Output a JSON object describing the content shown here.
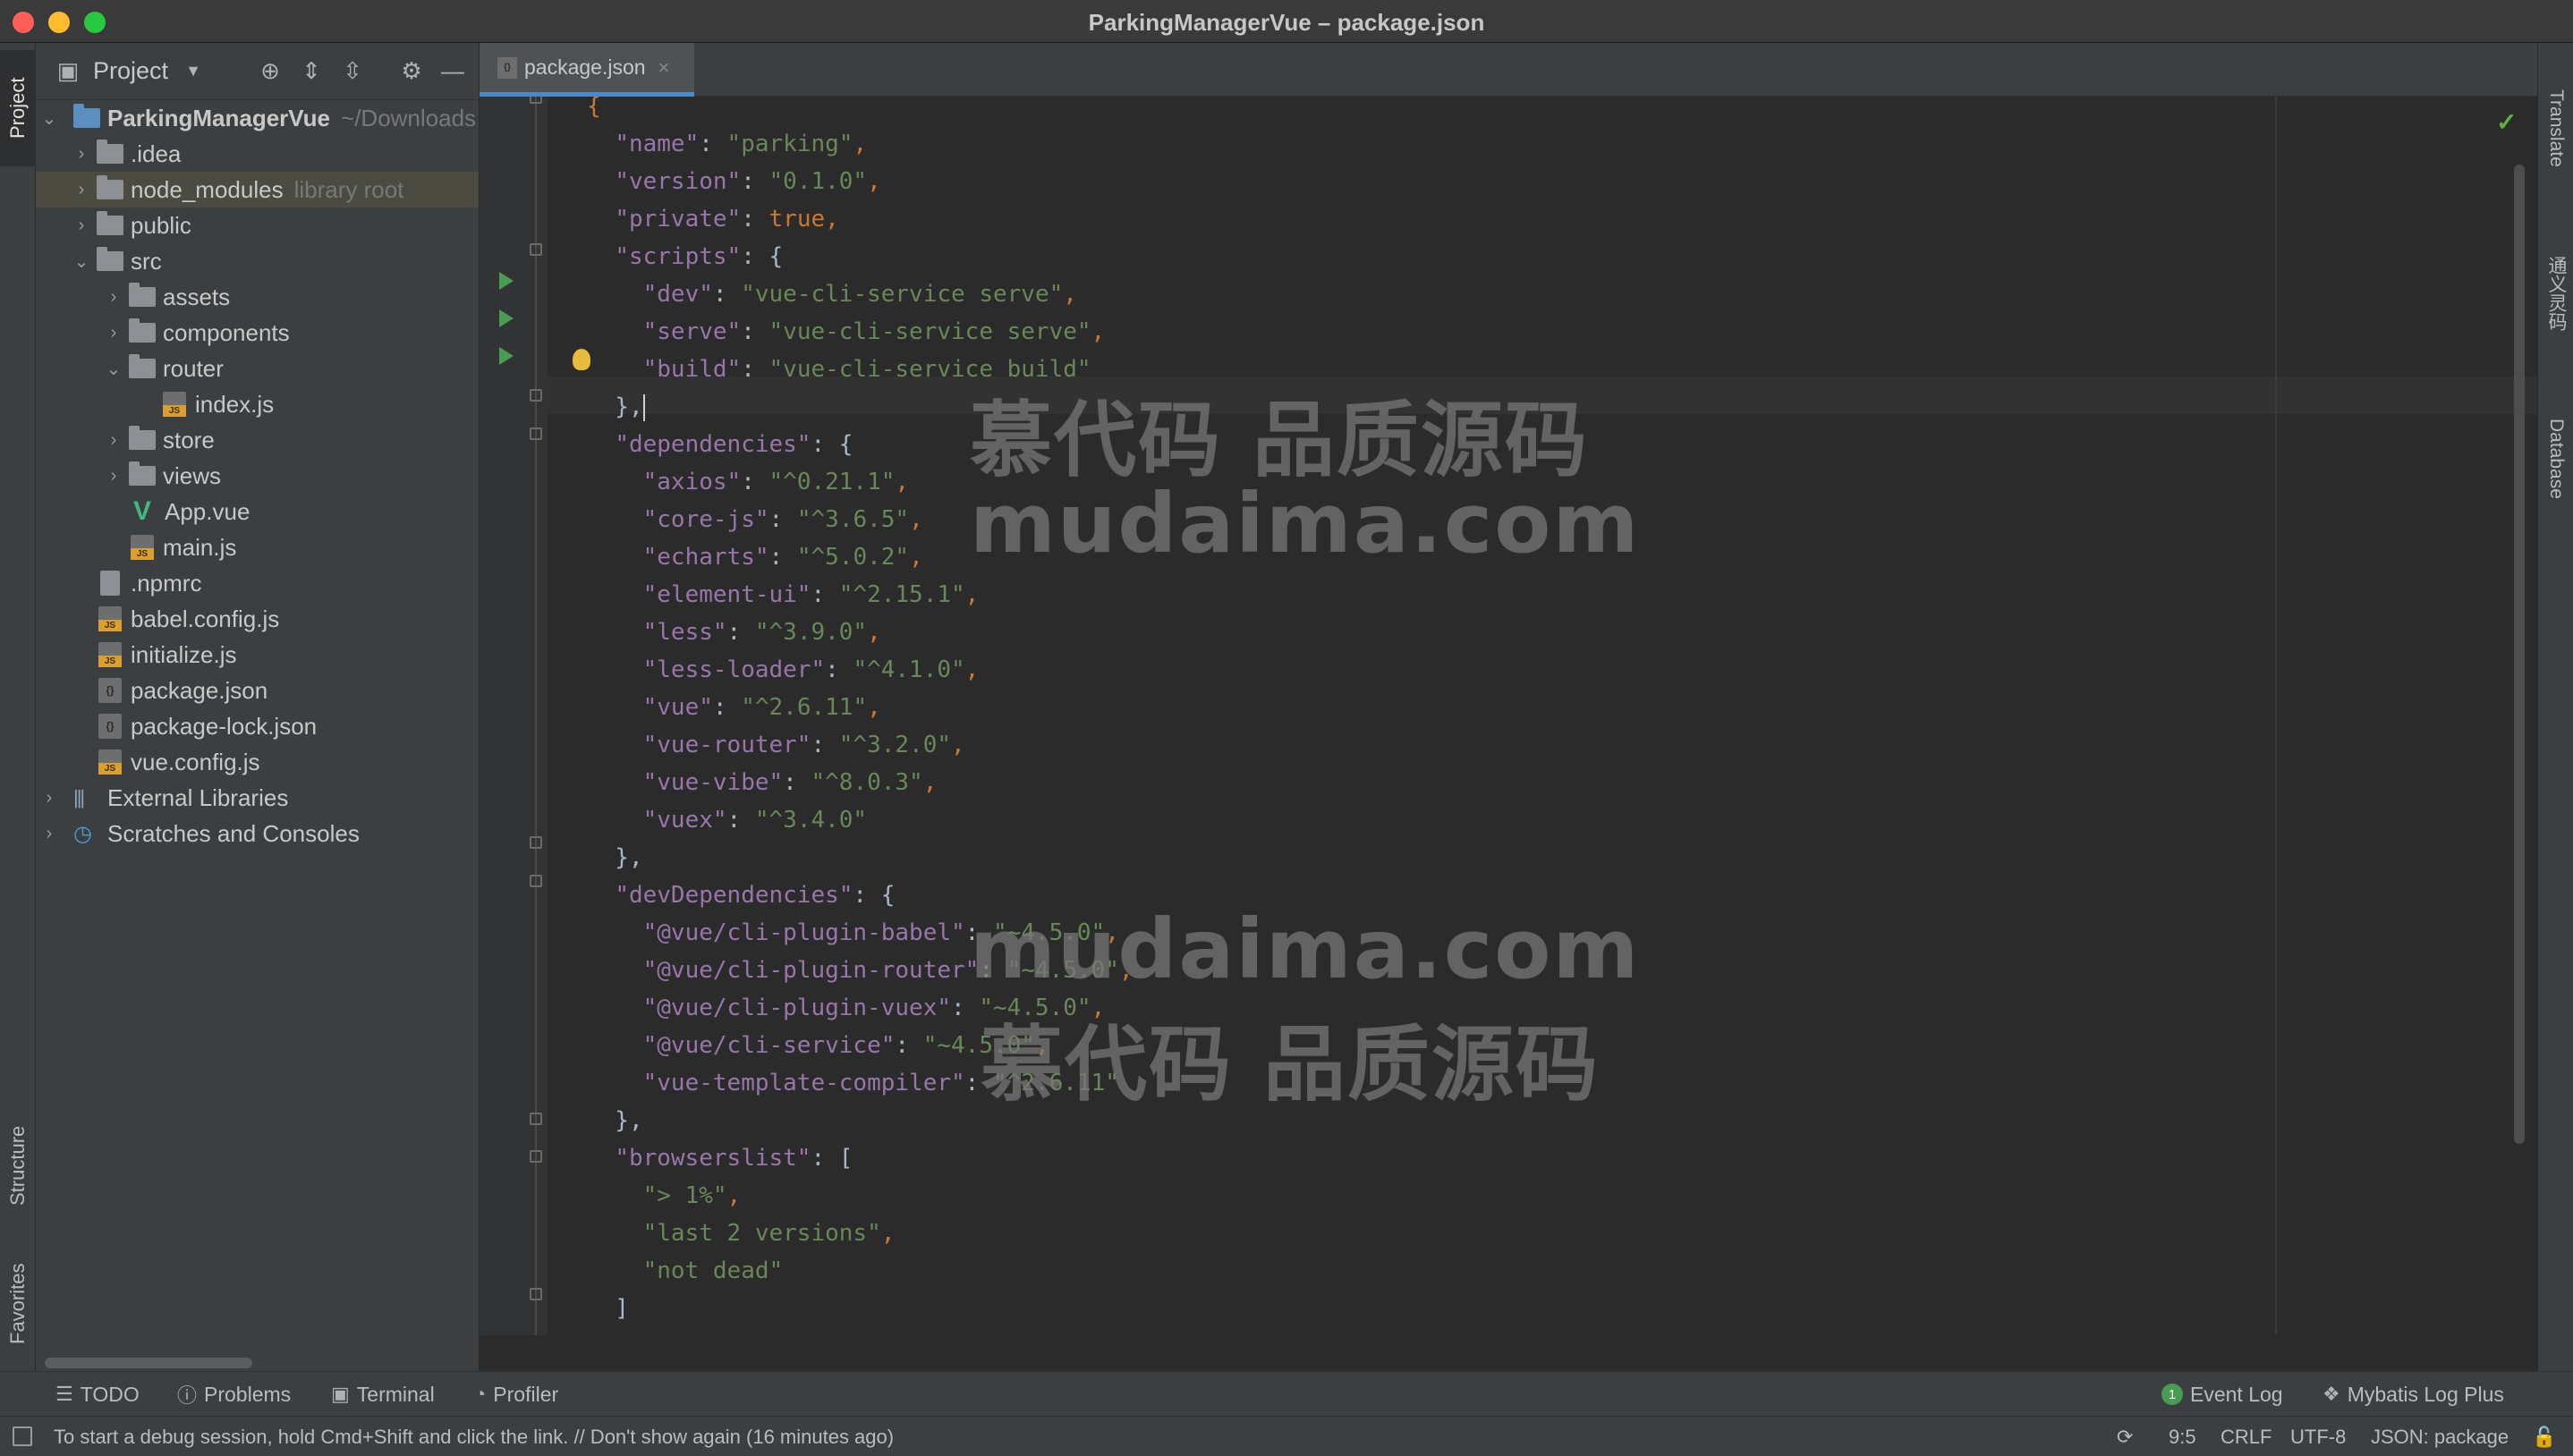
{
  "window": {
    "title": "ParkingManagerVue – package.json"
  },
  "left_strip": {
    "project_tab": "Project",
    "structure_tab": "Structure",
    "favorites_tab": "Favorites"
  },
  "right_strip": {
    "translate_tab": "Translate",
    "tongyi_tab": "通义灵码",
    "database_tab": "Database"
  },
  "project_panel": {
    "title": "Project",
    "tree": [
      {
        "label": "ParkingManagerVue",
        "hint": "~/Downloads",
        "kind": "module",
        "expanded": true
      },
      {
        "label": ".idea",
        "kind": "folder",
        "expanded": false
      },
      {
        "label": "node_modules",
        "hint": "library root",
        "kind": "folder",
        "expanded": false
      },
      {
        "label": "public",
        "kind": "folder",
        "expanded": false
      },
      {
        "label": "src",
        "kind": "folder",
        "expanded": true
      },
      {
        "label": "assets",
        "kind": "folder",
        "expanded": false
      },
      {
        "label": "components",
        "kind": "folder",
        "expanded": false
      },
      {
        "label": "router",
        "kind": "folder",
        "expanded": true
      },
      {
        "label": "index.js",
        "kind": "js"
      },
      {
        "label": "store",
        "kind": "folder",
        "expanded": false
      },
      {
        "label": "views",
        "kind": "folder",
        "expanded": false
      },
      {
        "label": "App.vue",
        "kind": "vue"
      },
      {
        "label": "main.js",
        "kind": "js"
      },
      {
        "label": ".npmrc",
        "kind": "file"
      },
      {
        "label": "babel.config.js",
        "kind": "js"
      },
      {
        "label": "initialize.js",
        "kind": "js"
      },
      {
        "label": "package.json",
        "kind": "json"
      },
      {
        "label": "package-lock.json",
        "kind": "json"
      },
      {
        "label": "vue.config.js",
        "kind": "js"
      },
      {
        "label": "External Libraries",
        "kind": "library"
      },
      {
        "label": "Scratches and Consoles",
        "kind": "scratch"
      }
    ]
  },
  "editor": {
    "tab_label": "package.json",
    "code": {
      "name": "\"parking\"",
      "version": "\"0.1.0\"",
      "private": "true",
      "dev": "\"vue-cli-service serve\"",
      "serve": "\"vue-cli-service serve\"",
      "build": "\"vue-cli-service build\"",
      "axios": "\"^0.21.1\"",
      "core_js": "\"^3.6.5\"",
      "echarts": "\"^5.0.2\"",
      "element_ui": "\"^2.15.1\"",
      "less": "\"^3.9.0\"",
      "less_loader": "\"^4.1.0\"",
      "vue": "\"^2.6.11\"",
      "vue_router": "\"^3.2.0\"",
      "vue_vibe": "\"^8.0.3\"",
      "vuex": "\"^3.4.0\"",
      "cli_plugin_babel": "\"~4.5.0\"",
      "cli_plugin_router": "\"~4.5.0\"",
      "cli_plugin_vuex": "\"~4.5.0\"",
      "cli_service": "\"~4.5.0\"",
      "vue_template_compiler": "\"^2.6.11\"",
      "browsers_1": "\"> 1%\"",
      "browsers_2": "\"last 2 versions\"",
      "browsers_3": "\"not dead\""
    },
    "keys": {
      "name": "\"name\"",
      "version": "\"version\"",
      "private": "\"private\"",
      "scripts": "\"scripts\"",
      "dev": "\"dev\"",
      "serve": "\"serve\"",
      "build": "\"build\"",
      "dependencies": "\"dependencies\"",
      "axios": "\"axios\"",
      "core_js": "\"core-js\"",
      "echarts": "\"echarts\"",
      "element_ui": "\"element-ui\"",
      "less": "\"less\"",
      "less_loader": "\"less-loader\"",
      "vue": "\"vue\"",
      "vue_router": "\"vue-router\"",
      "vue_vibe": "\"vue-vibe\"",
      "vuex": "\"vuex\"",
      "devDependencies": "\"devDependencies\"",
      "cli_plugin_babel": "\"@vue/cli-plugin-babel\"",
      "cli_plugin_router": "\"@vue/cli-plugin-router\"",
      "cli_plugin_vuex": "\"@vue/cli-plugin-vuex\"",
      "cli_service": "\"@vue/cli-service\"",
      "vue_template_compiler": "\"vue-template-compiler\"",
      "browserslist": "\"browserslist\""
    }
  },
  "watermarks": {
    "cn": "慕代码 品质源码",
    "en": "mudaima.com"
  },
  "bottom_tools": {
    "todo": "TODO",
    "problems": "Problems",
    "terminal": "Terminal",
    "profiler": "Profiler",
    "event_log": "Event Log",
    "event_count": "1",
    "mybatis": "Mybatis Log Plus"
  },
  "status": {
    "message": "To start a debug session, hold Cmd+Shift and click the link. // Don't show again (16 minutes ago)",
    "position": "9:5",
    "line_sep": "CRLF",
    "encoding": "UTF-8",
    "schema": "JSON: package"
  },
  "colors": {
    "accent": "#4a88c7",
    "key": "#9876aa",
    "string": "#6a8759",
    "keyword": "#cc7832",
    "run": "#499c54"
  }
}
